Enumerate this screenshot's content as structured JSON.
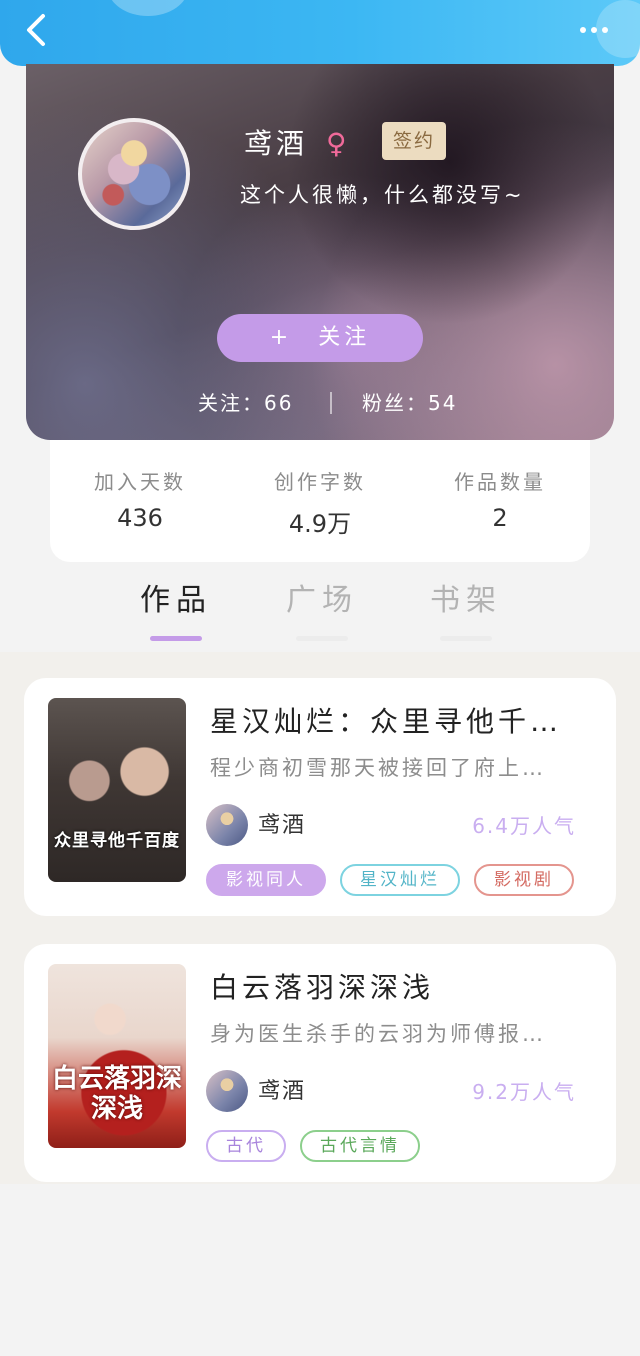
{
  "header": {
    "back_icon": "chevron-left-icon",
    "more_icon": "more-dots-icon",
    "color": "#2fa7ec"
  },
  "profile": {
    "name": "鸢酒",
    "gender_symbol": "♀",
    "sign_badge": "签约",
    "bio": "这个人很懒，什么都没写~",
    "follow_button": "+　关注",
    "following_label": "关注：",
    "following_count": "66",
    "fans_label": "粉丝：",
    "fans_count": "54"
  },
  "stats": [
    {
      "label": "加入天数",
      "value": "436"
    },
    {
      "label": "创作字数",
      "value": "4.9万"
    },
    {
      "label": "作品数量",
      "value": "2"
    }
  ],
  "tabs": [
    {
      "label": "作品",
      "active": true
    },
    {
      "label": "广场",
      "active": false
    },
    {
      "label": "书架",
      "active": false
    }
  ],
  "works": [
    {
      "title": "星汉灿烂：众里寻他千…",
      "description": "程少商初雪那天被接回了府上…",
      "cover_text": "众里寻他千百度",
      "author": "鸢酒",
      "popularity": "6.4万人气",
      "tags": [
        "影视同人",
        "星汉灿烂",
        "影视剧"
      ]
    },
    {
      "title": "白云落羽深深浅",
      "description": "身为医生杀手的云羽为师傅报…",
      "cover_text": "白云落羽深深浅",
      "author": "鸢酒",
      "popularity": "9.2万人气",
      "tags": [
        "古代",
        "古代言情"
      ]
    }
  ],
  "colors": {
    "accent": "#c49be8",
    "popularity": "#c9aef0"
  }
}
